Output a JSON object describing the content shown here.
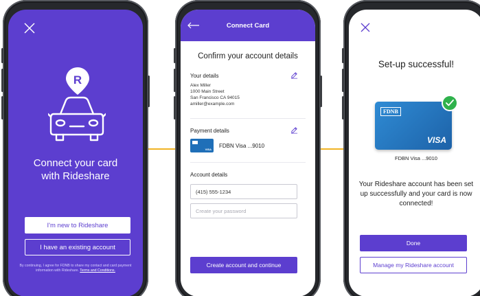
{
  "colors": {
    "brand": "#5c3ecf",
    "connector": "#f0b323",
    "card": "#1f6fb8",
    "success": "#2fb24c"
  },
  "screen1": {
    "close_icon": "close-icon",
    "logo_letter": "R",
    "headline_line1": "Connect your card",
    "headline_line2": "with Rideshare",
    "new_button": "I'm new to Rideshare",
    "existing_button": "I have an existing account",
    "legal_text": "By continuing, I agree for FDNB to share my contact and card payment information with Rideshare.",
    "legal_link": "Terms and Conditions."
  },
  "screen2": {
    "title": "Connect Card",
    "heading": "Confirm your account details",
    "your_details_label": "Your details",
    "name": "Alex Miller",
    "street": "1000 Main Street",
    "city": "San Francisco CA 94015",
    "email": "amiller@example.com",
    "payment_label": "Payment details",
    "card_name": "FDBN Visa ...9010",
    "mini_card_brand": "VISA",
    "account_label": "Account details",
    "phone_value": "(415) 555-1234",
    "password_placeholder": "Create your password",
    "submit_button": "Create account and continue"
  },
  "screen3": {
    "heading": "Set-up successful!",
    "card_bank": "FDNB",
    "card_brand": "VISA",
    "card_caption": "FDBN Visa ...9010",
    "message": "Your Rideshare account has been set up successfully and your card is now connected!",
    "done_button": "Done",
    "manage_button": "Manage my Rideshare account"
  }
}
